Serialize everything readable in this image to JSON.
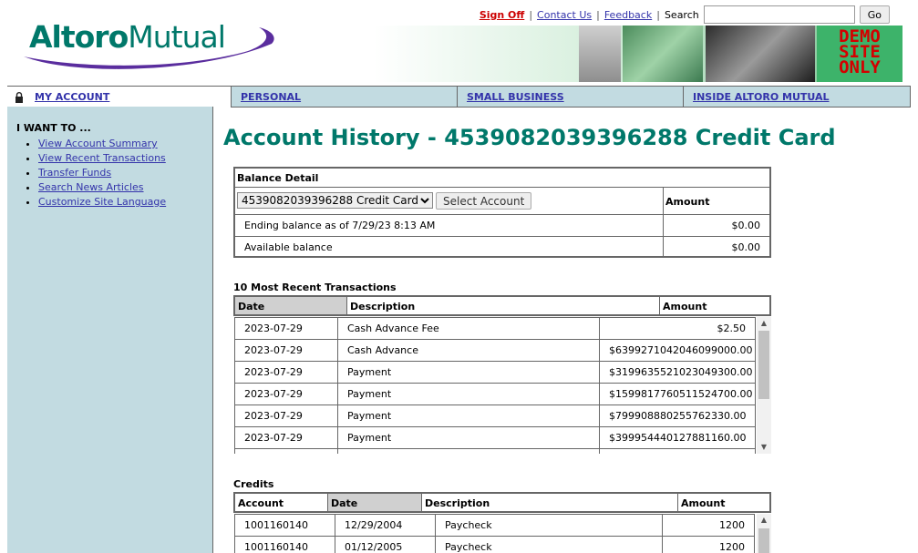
{
  "logo": {
    "part1": "Altoro",
    "part2": "Mutual"
  },
  "toplinks": {
    "signoff": "Sign Off",
    "contact": "Contact Us",
    "feedback": "Feedback",
    "search_label": "Search",
    "go": "Go"
  },
  "banner": {
    "demo": "DEMO SITE ONLY"
  },
  "nav": {
    "my_account": "MY ACCOUNT",
    "personal": "PERSONAL",
    "small_business": "SMALL BUSINESS",
    "inside": "INSIDE ALTORO MUTUAL"
  },
  "sidebar": {
    "heading": "I WANT TO ...",
    "links": [
      "View Account Summary",
      "View Recent Transactions",
      "Transfer Funds",
      "Search News Articles",
      "Customize Site Language"
    ]
  },
  "page_title": "Account History - 4539082039396288 Credit Card",
  "balance": {
    "title": "Balance Detail",
    "select_value": "4539082039396288 Credit Card",
    "select_button": "Select Account",
    "amount_header": "Amount",
    "rows": [
      {
        "label": "Ending balance as of 7/29/23 8:13 AM",
        "amount": "$0.00"
      },
      {
        "label": "Available balance",
        "amount": "$0.00"
      }
    ]
  },
  "transactions": {
    "title": "10 Most Recent Transactions",
    "headers": [
      "Date",
      "Description",
      "Amount"
    ],
    "rows": [
      [
        "2023-07-29",
        "Cash Advance Fee",
        "$2.50"
      ],
      [
        "2023-07-29",
        "Cash Advance",
        "$6399271042046099000.00"
      ],
      [
        "2023-07-29",
        "Payment",
        "$3199635521023049300.00"
      ],
      [
        "2023-07-29",
        "Payment",
        "$1599817760511524700.00"
      ],
      [
        "2023-07-29",
        "Payment",
        "$799908880255762330.00"
      ],
      [
        "2023-07-29",
        "Payment",
        "$399954440127881160.00"
      ]
    ]
  },
  "credits": {
    "title": "Credits",
    "headers": [
      "Account",
      "Date",
      "Description",
      "Amount"
    ],
    "rows": [
      [
        "1001160140",
        "12/29/2004",
        "Paycheck",
        "1200"
      ],
      [
        "1001160140",
        "01/12/2005",
        "Paycheck",
        "1200"
      ]
    ]
  }
}
